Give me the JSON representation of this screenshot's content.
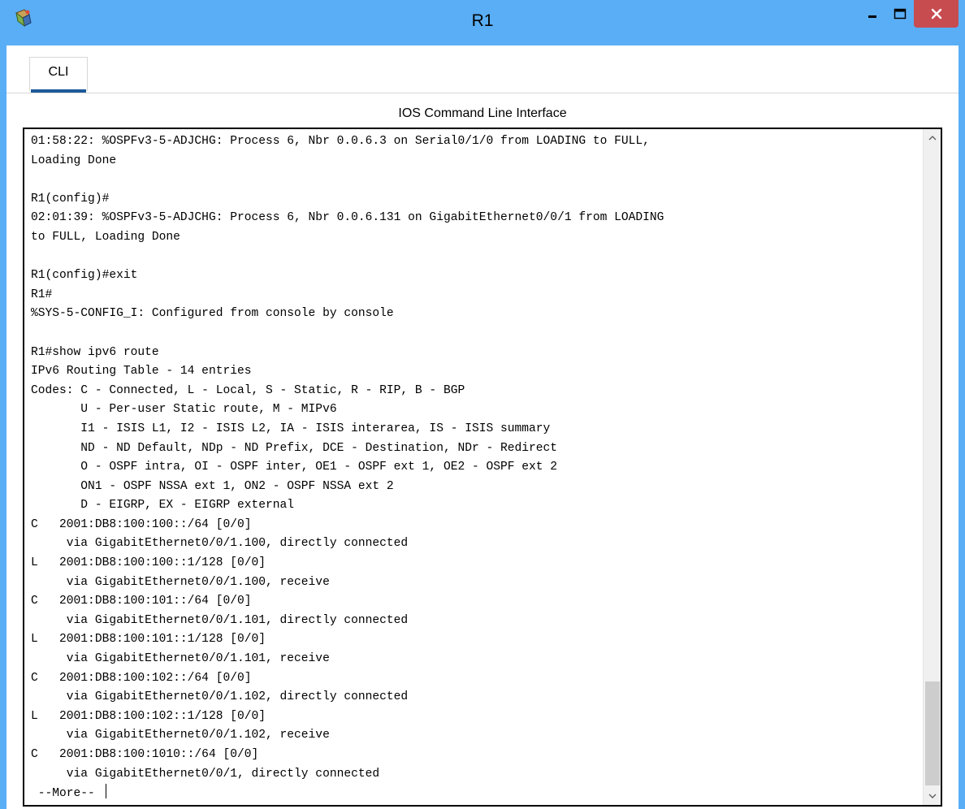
{
  "window": {
    "title": "R1",
    "icon": "packet-tracer-router-icon",
    "controls": {
      "minimize_icon": "minimize-icon",
      "maximize_icon": "maximize-icon",
      "close_icon": "close-icon"
    }
  },
  "tabs": [
    {
      "label": "CLI",
      "active": true
    }
  ],
  "pane": {
    "heading": "IOS Command Line Interface"
  },
  "terminal": {
    "lines": [
      "01:58:22: %OSPFv3-5-ADJCHG: Process 6, Nbr 0.0.6.3 on Serial0/1/0 from LOADING to FULL,",
      "Loading Done",
      "",
      "R1(config)#",
      "02:01:39: %OSPFv3-5-ADJCHG: Process 6, Nbr 0.0.6.131 on GigabitEthernet0/0/1 from LOADING",
      "to FULL, Loading Done",
      "",
      "R1(config)#exit",
      "R1#",
      "%SYS-5-CONFIG_I: Configured from console by console",
      "",
      "R1#show ipv6 route",
      "IPv6 Routing Table - 14 entries",
      "Codes: C - Connected, L - Local, S - Static, R - RIP, B - BGP",
      "       U - Per-user Static route, M - MIPv6",
      "       I1 - ISIS L1, I2 - ISIS L2, IA - ISIS interarea, IS - ISIS summary",
      "       ND - ND Default, NDp - ND Prefix, DCE - Destination, NDr - Redirect",
      "       O - OSPF intra, OI - OSPF inter, OE1 - OSPF ext 1, OE2 - OSPF ext 2",
      "       ON1 - OSPF NSSA ext 1, ON2 - OSPF NSSA ext 2",
      "       D - EIGRP, EX - EIGRP external",
      "C   2001:DB8:100:100::/64 [0/0]",
      "     via GigabitEthernet0/0/1.100, directly connected",
      "L   2001:DB8:100:100::1/128 [0/0]",
      "     via GigabitEthernet0/0/1.100, receive",
      "C   2001:DB8:100:101::/64 [0/0]",
      "     via GigabitEthernet0/0/1.101, directly connected",
      "L   2001:DB8:100:101::1/128 [0/0]",
      "     via GigabitEthernet0/0/1.101, receive",
      "C   2001:DB8:100:102::/64 [0/0]",
      "     via GigabitEthernet0/0/1.102, directly connected",
      "L   2001:DB8:100:102::1/128 [0/0]",
      "     via GigabitEthernet0/0/1.102, receive",
      "C   2001:DB8:100:1010::/64 [0/0]",
      "     via GigabitEthernet0/0/1, directly connected"
    ],
    "more_prompt": " --More-- ",
    "scrollbar": {
      "up_icon": "chevron-up-icon",
      "down_icon": "chevron-down-icon"
    }
  }
}
